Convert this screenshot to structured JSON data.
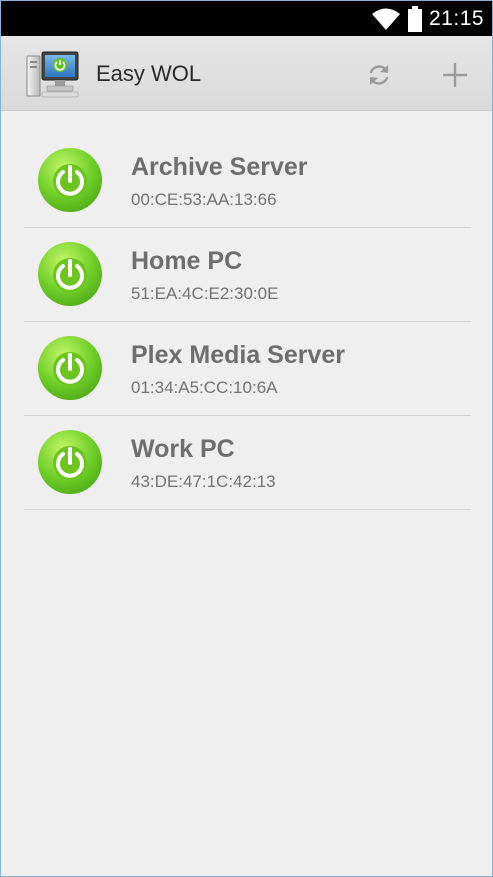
{
  "status_bar": {
    "time": "21:15",
    "icons": [
      "wifi-icon",
      "battery-icon"
    ]
  },
  "app_bar": {
    "title": "Easy WOL",
    "icon": "computer-power-icon",
    "actions": [
      "refresh-icon",
      "add-icon"
    ]
  },
  "devices": [
    {
      "name": "Archive Server",
      "mac": "00:CE:53:AA:13:66"
    },
    {
      "name": "Home PC",
      "mac": "51:EA:4C:E2:30:0E"
    },
    {
      "name": "Plex Media Server",
      "mac": "01:34:A5:CC:10:6A"
    },
    {
      "name": "Work PC",
      "mac": "43:DE:47:1C:42:13"
    }
  ],
  "colors": {
    "status_bar": "#000000",
    "action_bar": "#e0e0e0",
    "background": "#efefef",
    "power_button_green": "#6fc62a",
    "text_primary": "#6e6e6e",
    "divider": "#d4d4d4"
  }
}
